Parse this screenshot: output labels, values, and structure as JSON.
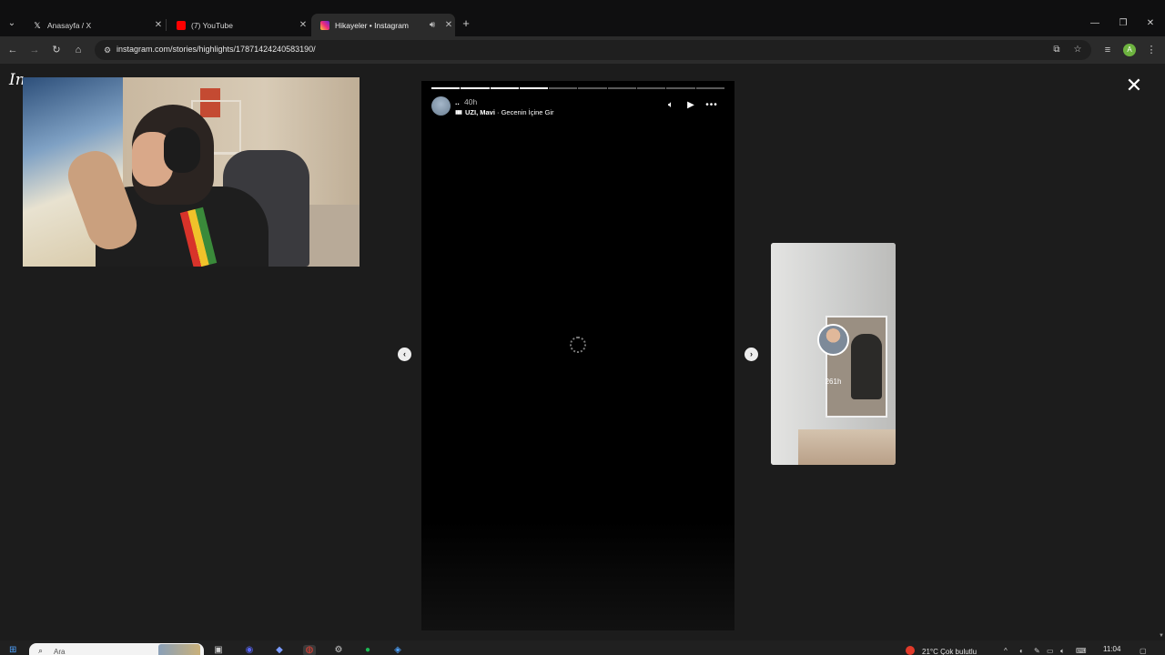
{
  "browser": {
    "tabs": [
      {
        "title": "Anasayfa / X",
        "icon": "x-logo-icon",
        "active": false
      },
      {
        "title": "(7) YouTube",
        "icon": "youtube-icon",
        "active": false
      },
      {
        "title": "Hikayeler • Instagram",
        "icon": "instagram-icon",
        "active": true,
        "audio": true
      }
    ],
    "url": "instagram.com/stories/highlights/17871424240583190/",
    "profile_initial": "A",
    "accent": "#6db33f"
  },
  "instagram": {
    "logo_text": "In",
    "story": {
      "username": "..",
      "time": "40h",
      "music_artist": "UZI, Mavi",
      "music_title": " · Gecenin İçine Gir",
      "segments_total": 10,
      "segments_done": 4
    },
    "next_story": {
      "username": "",
      "time": "261h"
    }
  },
  "taskbar": {
    "search_placeholder": "Ara",
    "weather": "21°C  Çok bulutlu",
    "clock": "11:04"
  }
}
